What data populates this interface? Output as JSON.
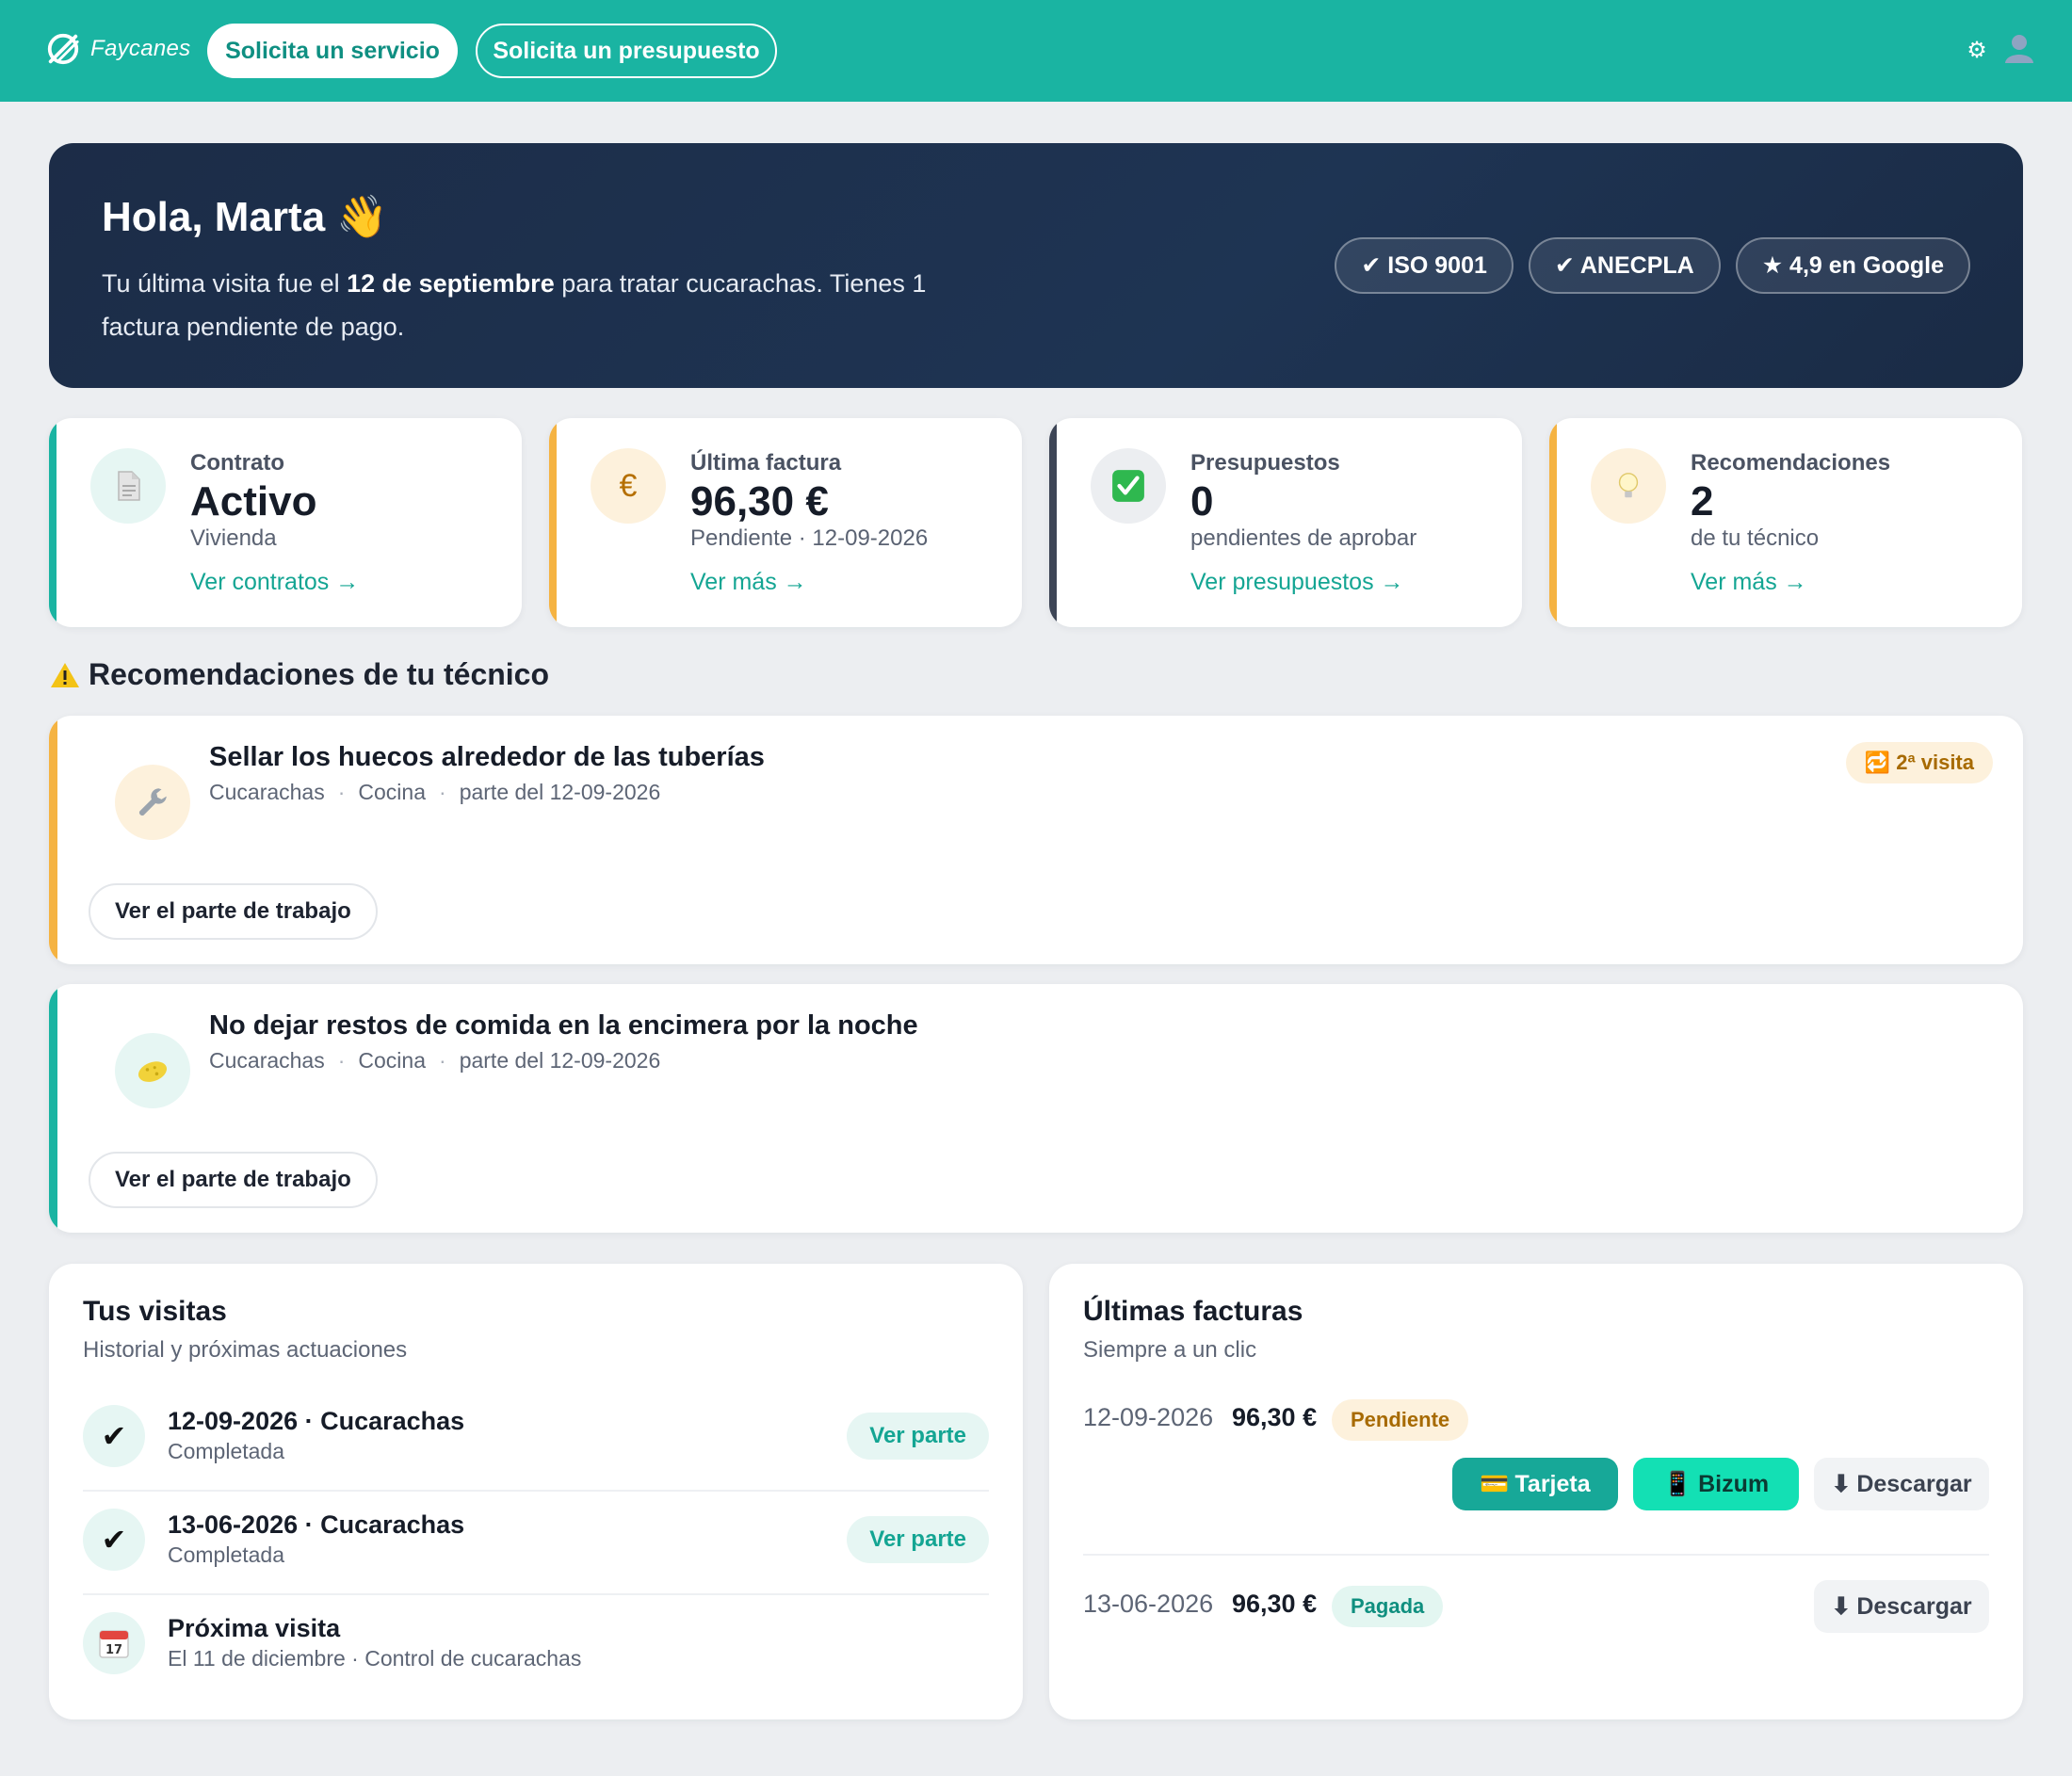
{
  "topbar": {
    "brand": "Faycanes",
    "request_service": "Solicita un servicio",
    "request_quote": "Solicita un presupuesto"
  },
  "hero": {
    "title": "Hola, Marta",
    "text_before": "Tu última visita fue el ",
    "text_date": "12 de septiembre",
    "text_after": " para tratar cucarachas. Tienes 1 factura pendiente de pago.",
    "badges": [
      "✔ ISO 9001",
      "✔ ANECPLA",
      "★ 4,9 en Google"
    ]
  },
  "stats": [
    {
      "label": "Contrato",
      "value": "Activo",
      "sub": "Vivienda",
      "link": "Ver contratos →",
      "icon": "document-icon"
    },
    {
      "label": "Última factura",
      "value": "96,30 €",
      "sub": "Pendiente · 12-09-2026",
      "link": "Ver más →",
      "icon": "euro-icon"
    },
    {
      "label": "Presupuestos",
      "value": "0",
      "sub": "pendientes de aprobar",
      "link": "Ver presupuestos →",
      "icon": "check-icon"
    },
    {
      "label": "Recomendaciones",
      "value": "2",
      "sub": "de tu técnico",
      "link": "Ver más →",
      "icon": "lightbulb-icon"
    }
  ],
  "recommendations_title": "Recomendaciones de tu técnico",
  "recommendations": [
    {
      "title": "Sellar los huecos alrededor de las tuberías",
      "pest": "Cucarachas",
      "room": "Cocina",
      "report": "parte del 12-09-2026",
      "button": "Ver el parte de trabajo",
      "tag": "2ª visita",
      "icon": "wrench-icon"
    },
    {
      "title": "No dejar restos de comida en la encimera por la noche",
      "pest": "Cucarachas",
      "room": "Cocina",
      "report": "parte del 12-09-2026",
      "button": "Ver el parte de trabajo",
      "icon": "sponge-icon"
    }
  ],
  "visits": {
    "title": "Tus visitas",
    "subtitle": "Historial y próximas actuaciones",
    "items": [
      {
        "title": "12-09-2026 · Cucarachas",
        "status": "Completada",
        "button": "Ver parte"
      },
      {
        "title": "13-06-2026 · Cucarachas",
        "status": "Completada",
        "button": "Ver parte"
      },
      {
        "title": "Próxima visita",
        "status": "El 11 de diciembre · Control de cucarachas",
        "calendar_day": "17"
      }
    ]
  },
  "invoices": {
    "title": "Últimas facturas",
    "subtitle": "Siempre a un clic",
    "items": [
      {
        "date": "12-09-2026",
        "amount": "96,30 €",
        "status": "Pendiente",
        "pay_card": "Tarjeta",
        "pay_bizum": "Bizum",
        "download": "Descargar"
      },
      {
        "date": "13-06-2026",
        "amount": "96,30 €",
        "status": "Pagada",
        "download": "Descargar"
      }
    ]
  },
  "colors": {
    "brand": "#1ab4a2",
    "hero_bg": "#1c2c47",
    "accent_teal": "#14a593",
    "accent_orange": "#f5b342",
    "accent_dark": "#3d4556"
  }
}
